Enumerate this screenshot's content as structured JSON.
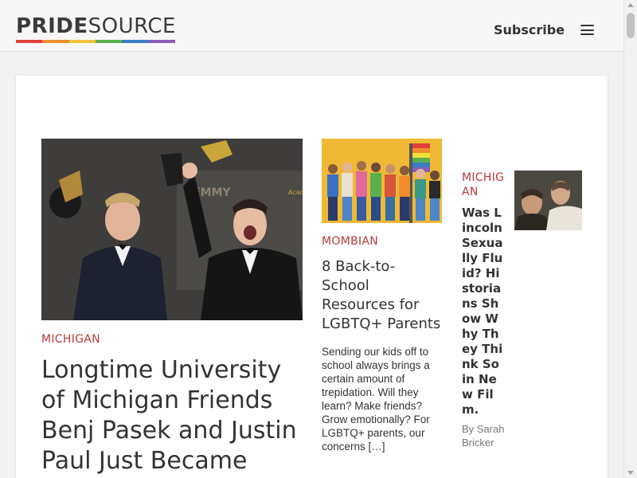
{
  "header": {
    "logo_bold": "PRIDE",
    "logo_light": "SOURCE",
    "rainbow_colors": [
      "#e0403a",
      "#f08c2e",
      "#f2c33a",
      "#5cae4e",
      "#3b7dc4",
      "#8a5cb8"
    ],
    "subscribe_label": "Subscribe",
    "menu_icon": "hamburger-menu-icon"
  },
  "colors": {
    "category": "#b83a3a",
    "text": "#333333",
    "background": "#f2f2f2",
    "card": "#ffffff"
  },
  "articles": [
    {
      "category": "MICHIGAN",
      "title": "Longtime University of Michigan Friends Benj Pasek and Justin Paul Just Became",
      "image_alt": "Two men in tuxedos holding Emmy awards"
    },
    {
      "category": "MOMBIAN",
      "title": "8 Back-to-School Resources for LGBTQ+ Parents",
      "excerpt": "Sending our kids off to school always brings a certain amount of trepidation. Will they learn? Make friends? Grow emotionally? For LGBTQ+ parents, our concerns […]",
      "image_alt": "Group of young people with rainbow flag against yellow wall"
    },
    {
      "category": "MICHIGAN",
      "title": "Was Lincoln Sexually Fluid? Historians Show Why They Think So in New Film.",
      "byline": "By Sarah Bricker",
      "image_alt": "Two men in historical scene"
    }
  ]
}
